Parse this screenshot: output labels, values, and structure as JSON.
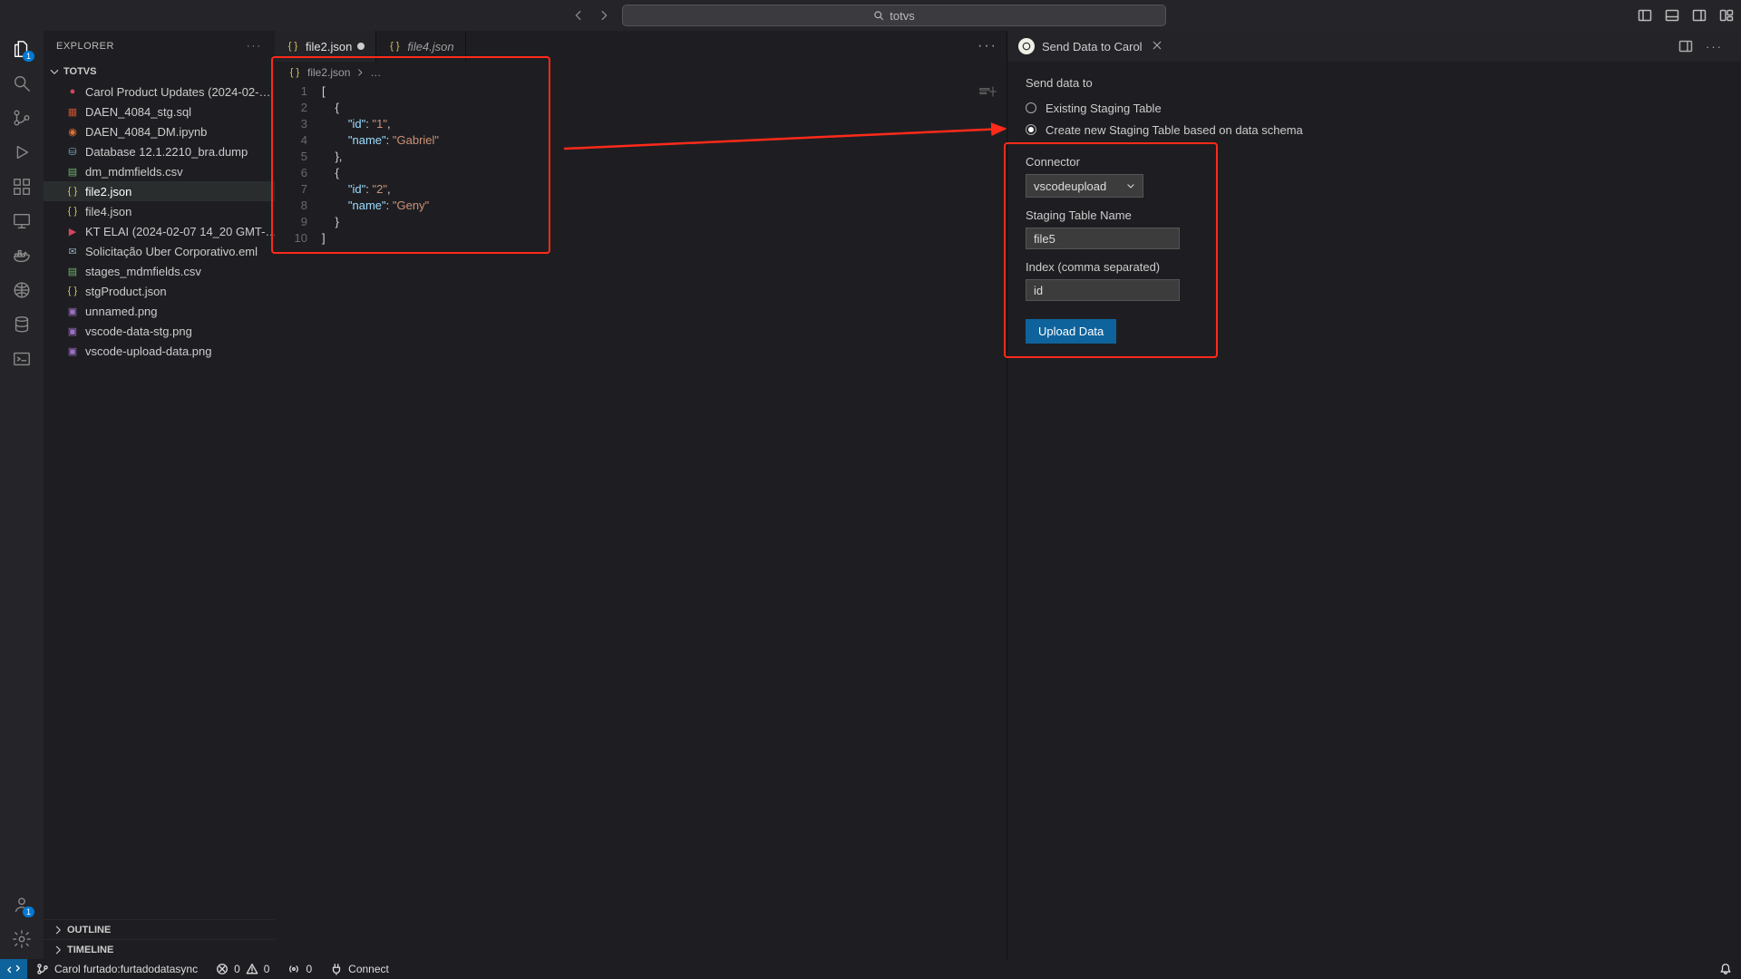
{
  "titlebar": {
    "search_text": "totvs"
  },
  "activitybar": {
    "explorer_badge": "1",
    "account_badge": "1"
  },
  "explorer": {
    "title": "EXPLORER",
    "folder": "TOTVS",
    "files": [
      {
        "name": "Carol Product Updates (2024-02-…",
        "kind": "rec"
      },
      {
        "name": "DAEN_4084_stg.sql",
        "kind": "sql"
      },
      {
        "name": "DAEN_4084_DM.ipynb",
        "kind": "ipynb"
      },
      {
        "name": "Database 12.1.2210_bra.dump",
        "kind": "db"
      },
      {
        "name": "dm_mdmfields.csv",
        "kind": "csv"
      },
      {
        "name": "file2.json",
        "kind": "json",
        "selected": true
      },
      {
        "name": "file4.json",
        "kind": "json"
      },
      {
        "name": "KT ELAI (2024-02-07 14_20 GMT-…",
        "kind": "video"
      },
      {
        "name": "Solicitação Uber Corporativo.eml",
        "kind": "mail"
      },
      {
        "name": "stages_mdmfields.csv",
        "kind": "csv"
      },
      {
        "name": "stgProduct.json",
        "kind": "json"
      },
      {
        "name": "unnamed.png",
        "kind": "png"
      },
      {
        "name": "vscode-data-stg.png",
        "kind": "png"
      },
      {
        "name": "vscode-upload-data.png",
        "kind": "png"
      }
    ],
    "outline": "OUTLINE",
    "timeline": "TIMELINE"
  },
  "editor": {
    "tabs": [
      {
        "label": "file2.json",
        "active": true,
        "dirty": true
      },
      {
        "label": "file4.json",
        "active": false,
        "italic": true
      }
    ],
    "breadcrumb_file": "file2.json",
    "breadcrumb_more": "…",
    "lines": [
      "[",
      "    {",
      "        \"id\": \"1\",",
      "        \"name\": \"Gabriel\"",
      "    },",
      "    {",
      "        \"id\": \"2\",",
      "        \"name\": \"Geny\"",
      "    }",
      "]"
    ]
  },
  "rightpanel": {
    "title": "Send Data to Carol",
    "heading": "Send data to",
    "radio1": "Existing Staging Table",
    "radio2": "Create new Staging Table based on data schema",
    "connector_label": "Connector",
    "connector_value": "vscodeupload",
    "staging_label": "Staging Table Name",
    "staging_value": "file5",
    "index_label": "Index (comma separated)",
    "index_value": "id",
    "upload_button": "Upload Data"
  },
  "statusbar": {
    "branch": "Carol furtado:furtadodatasync",
    "errors": "0",
    "warnings": "0",
    "ports": "0",
    "connect": "Connect"
  }
}
